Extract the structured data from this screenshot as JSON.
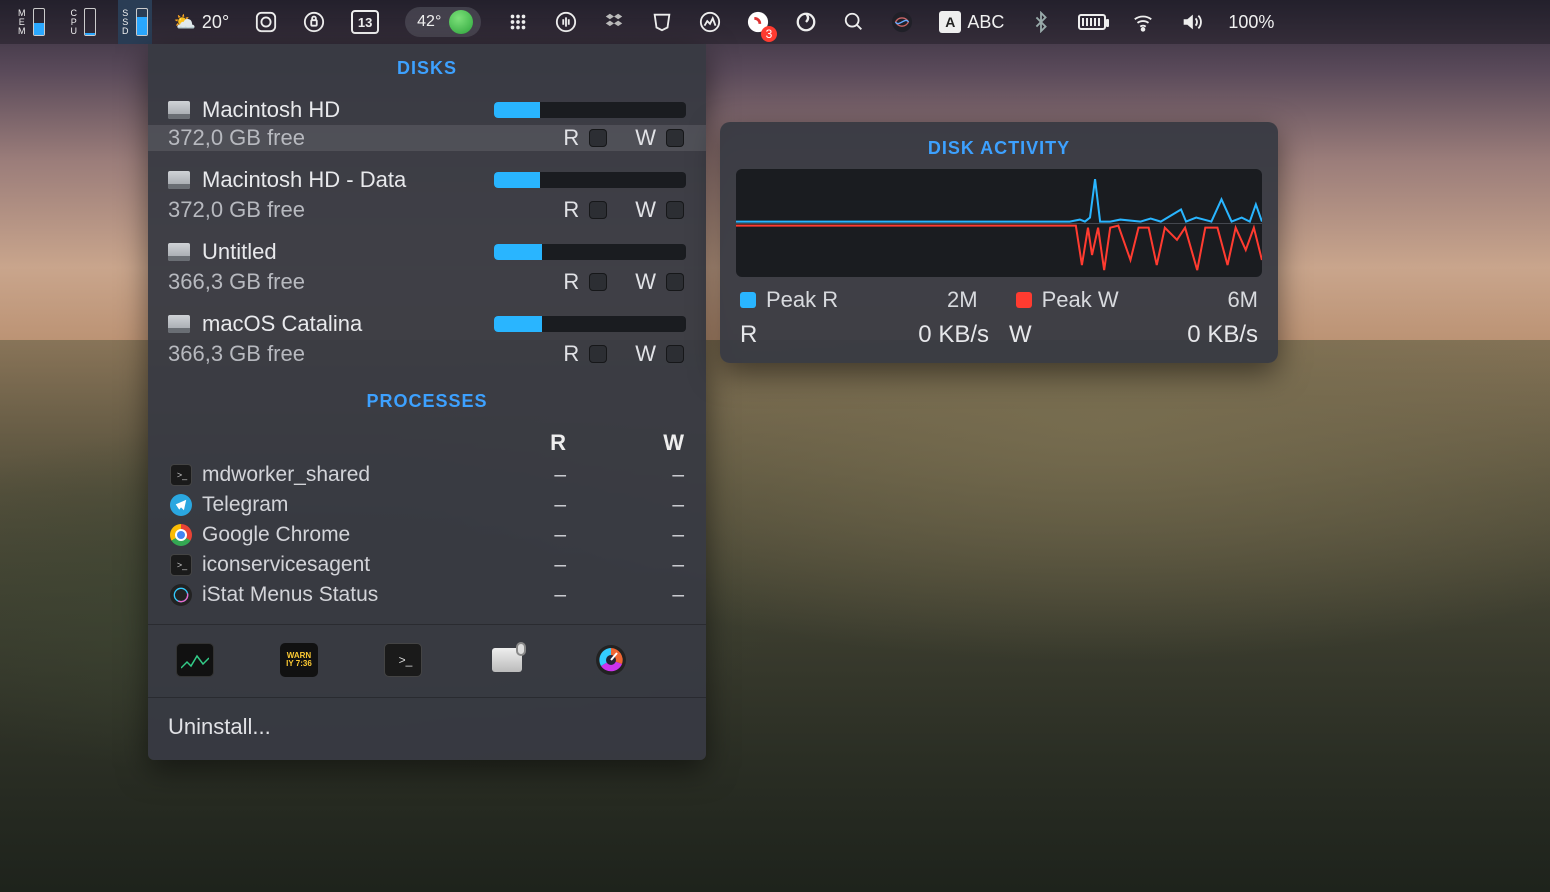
{
  "menubar": {
    "mem_label": "MEM",
    "cpu_label": "CPU",
    "ssd_label": "SSD",
    "weather_temp": "20°",
    "calendar_day": "13",
    "pill_temp": "42°",
    "input_label": "ABC",
    "battery_pct": "100%",
    "notification_badge": "3"
  },
  "panel": {
    "disks_title": "DISKS",
    "processes_title": "PROCESSES",
    "r_label": "R",
    "w_label": "W",
    "uninstall": "Uninstall..."
  },
  "disks": [
    {
      "name": "Macintosh HD",
      "free": "372,0 GB free",
      "fill_pct": 24,
      "highlight": true
    },
    {
      "name": "Macintosh HD - Data",
      "free": "372,0 GB free",
      "fill_pct": 24,
      "highlight": false
    },
    {
      "name": "Untitled",
      "free": "366,3 GB free",
      "fill_pct": 25,
      "highlight": false
    },
    {
      "name": "macOS Catalina",
      "free": "366,3 GB free",
      "fill_pct": 25,
      "highlight": false
    }
  ],
  "processes_header": {
    "r": "R",
    "w": "W"
  },
  "processes": [
    {
      "name": "mdworker_shared",
      "r": "–",
      "w": "–",
      "icon": "terminal"
    },
    {
      "name": "Telegram",
      "r": "–",
      "w": "–",
      "icon": "telegram"
    },
    {
      "name": "Google Chrome",
      "r": "–",
      "w": "–",
      "icon": "chrome"
    },
    {
      "name": "iconservicesagent",
      "r": "–",
      "w": "–",
      "icon": "terminal"
    },
    {
      "name": "iStat Menus Status",
      "r": "–",
      "w": "–",
      "icon": "istat"
    }
  ],
  "tools": [
    {
      "name": "activity-monitor"
    },
    {
      "name": "console"
    },
    {
      "name": "terminal"
    },
    {
      "name": "disk-utility"
    },
    {
      "name": "speedometer"
    }
  ],
  "activity": {
    "title": "DISK ACTIVITY",
    "peak_r_label": "Peak R",
    "peak_r_value": "2M",
    "peak_w_label": "Peak W",
    "peak_w_value": "6M",
    "r_label": "R",
    "r_value": "0 KB/s",
    "w_label": "W",
    "w_value": "0 KB/s"
  }
}
